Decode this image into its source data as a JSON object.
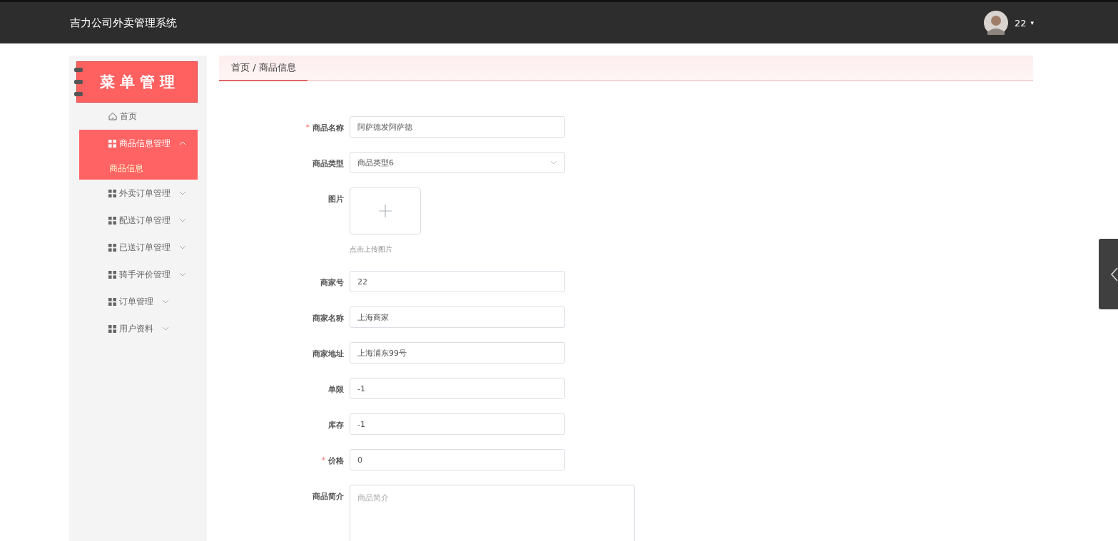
{
  "header": {
    "title": "吉力公司外卖管理系统",
    "user": {
      "name": "22",
      "caret": "▾"
    }
  },
  "sidebar": {
    "banner": "菜单管理",
    "items": [
      {
        "label": "首页",
        "kind": "link"
      },
      {
        "label": "商品信息管理",
        "kind": "menu",
        "expanded": true,
        "children": [
          {
            "label": "商品信息",
            "selected": true
          }
        ]
      },
      {
        "label": "外卖订单管理",
        "kind": "menu",
        "expanded": false
      },
      {
        "label": "配送订单管理",
        "kind": "menu",
        "expanded": false
      },
      {
        "label": "已送订单管理",
        "kind": "menu",
        "expanded": false
      },
      {
        "label": "骑手评价管理",
        "kind": "menu",
        "expanded": false
      },
      {
        "label": "订单管理",
        "kind": "menu",
        "expanded": false
      },
      {
        "label": "用户资料",
        "kind": "menu",
        "expanded": false
      }
    ]
  },
  "breadcrumb": "首页 / 商品信息",
  "form": [
    {
      "label": "商品名称",
      "kind": "input",
      "required_mark": "*",
      "value": "阿萨德发阿萨德"
    },
    {
      "label": "商品类型",
      "kind": "select",
      "value": "商品类型6"
    },
    {
      "label": "图片",
      "kind": "upload",
      "hint": "点击上传图片"
    },
    {
      "label": "商家号",
      "kind": "input",
      "value": "22"
    },
    {
      "label": "商家名称",
      "kind": "input",
      "value": "上海商家"
    },
    {
      "label": "商家地址",
      "kind": "input",
      "value": "上海浦东99号"
    },
    {
      "label": "单限",
      "kind": "input",
      "value": "-1"
    },
    {
      "label": "库存",
      "kind": "input",
      "value": "-1"
    },
    {
      "label": "价格",
      "kind": "input",
      "required_mark": "*",
      "value": "0"
    },
    {
      "label": "商品简介",
      "kind": "textarea",
      "placeholder": "商品简介"
    }
  ]
}
